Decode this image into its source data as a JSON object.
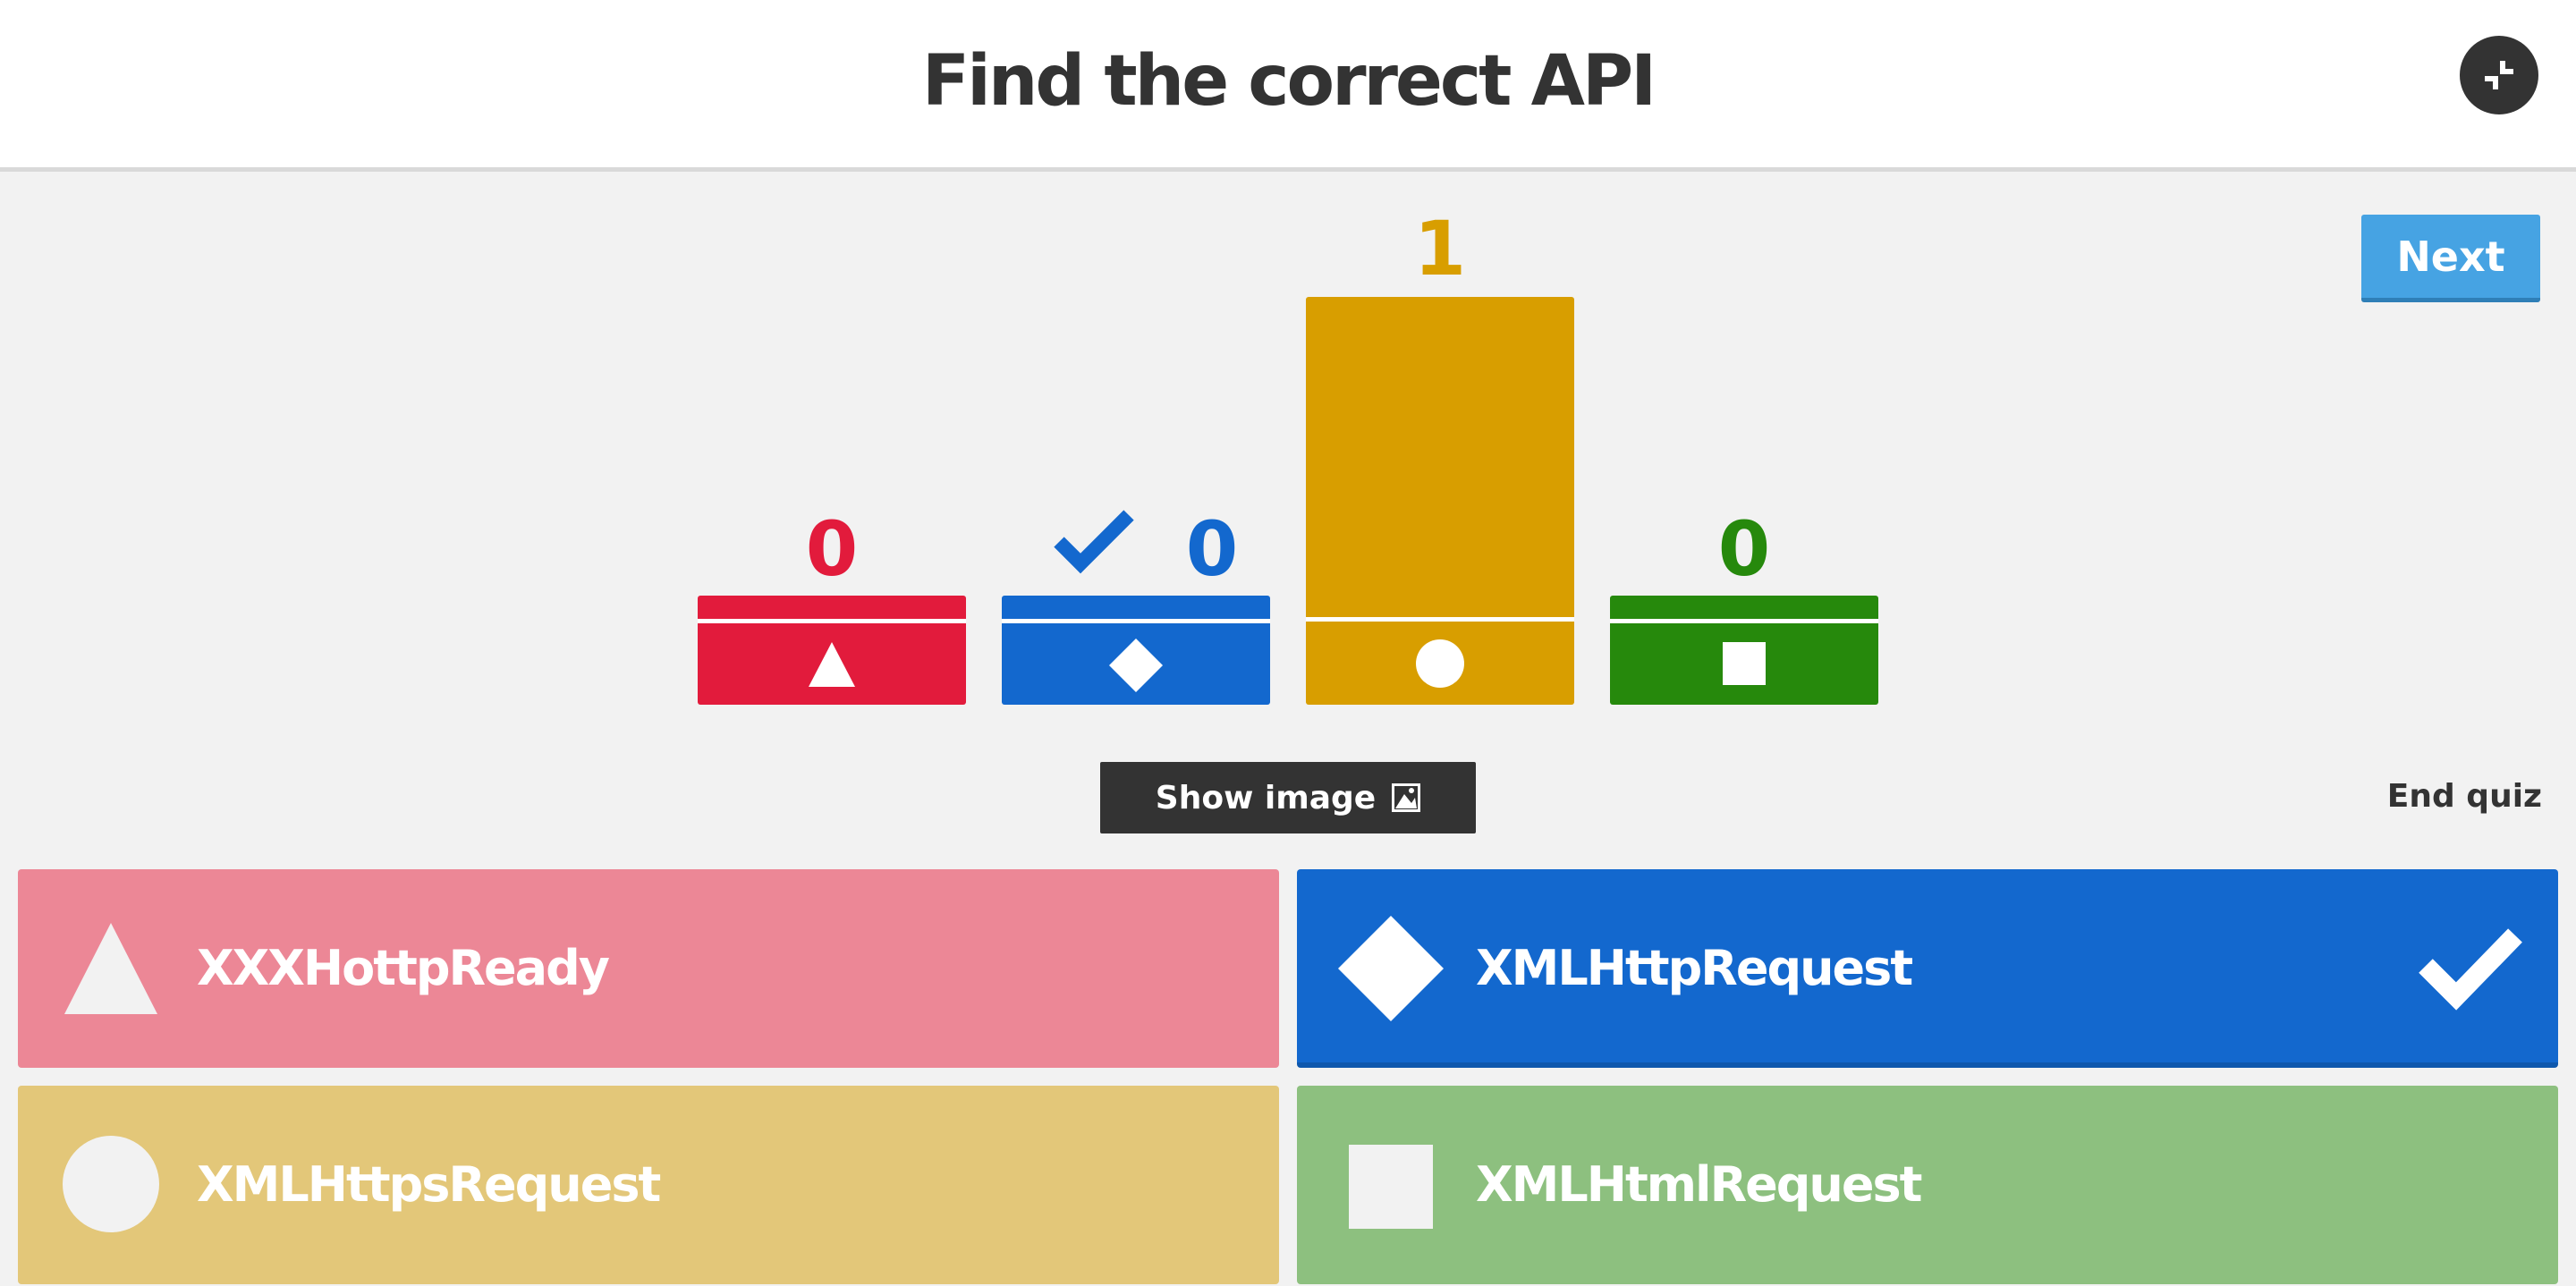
{
  "header": {
    "title": "Find the correct API",
    "fullscreen_icon": "fullscreen-exit-icon"
  },
  "controls": {
    "next_label": "Next",
    "show_image_label": "Show image",
    "show_image_icon": "image-icon",
    "end_quiz_label": "End quiz"
  },
  "results": [
    {
      "count": "0",
      "color": "#e21b3c",
      "shape": "triangle",
      "correct": false,
      "votes": 0
    },
    {
      "count": "0",
      "color": "#1368ce",
      "shape": "diamond",
      "correct": true,
      "votes": 0
    },
    {
      "count": "1",
      "color": "#d89e00",
      "shape": "circle",
      "correct": false,
      "votes": 1
    },
    {
      "count": "0",
      "color": "#26890c",
      "shape": "square",
      "correct": false,
      "votes": 0
    }
  ],
  "answers": [
    {
      "text": "XXXHottpReady",
      "color": "#ec8796",
      "shape": "triangle",
      "correct": false
    },
    {
      "text": "XMLHttpRequest",
      "color": "#1368ce",
      "shape": "diamond",
      "correct": true
    },
    {
      "text": "XMLHttpsRequest",
      "color": "#e3c779",
      "shape": "circle",
      "correct": false
    },
    {
      "text": "XMLHtmlRequest",
      "color": "#8dc07f",
      "shape": "square",
      "correct": false
    }
  ]
}
